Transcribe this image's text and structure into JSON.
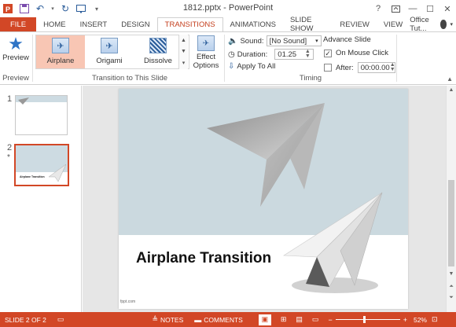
{
  "window": {
    "title": "1812.pptx - PowerPoint",
    "help_label": "?",
    "controls": [
      "restore-icon",
      "minimize-icon",
      "maximize-icon",
      "close-icon"
    ]
  },
  "tabs": [
    {
      "label": "FILE"
    },
    {
      "label": "HOME"
    },
    {
      "label": "INSERT"
    },
    {
      "label": "DESIGN"
    },
    {
      "label": "TRANSITIONS"
    },
    {
      "label": "ANIMATIONS"
    },
    {
      "label": "SLIDE SHOW"
    },
    {
      "label": "REVIEW"
    },
    {
      "label": "VIEW"
    }
  ],
  "account": {
    "label": "Office Tut..."
  },
  "ribbon": {
    "preview": {
      "label": "Preview",
      "group": "Preview"
    },
    "transitions": {
      "items": [
        {
          "label": "Airplane"
        },
        {
          "label": "Origami"
        },
        {
          "label": "Dissolve"
        }
      ],
      "group": "Transition to This Slide",
      "effect_options": "Effect Options"
    },
    "timing": {
      "sound_label": "Sound:",
      "sound_value": "[No Sound]",
      "duration_label": "Duration:",
      "duration_value": "01.25",
      "apply_all": "Apply To All",
      "advance_label": "Advance Slide",
      "on_click": "On Mouse Click",
      "on_click_checked": true,
      "after_label": "After:",
      "after_value": "00:00.00",
      "after_checked": false,
      "group": "Timing"
    }
  },
  "thumbnails": [
    {
      "num": "1",
      "title": ""
    },
    {
      "num": "2",
      "title": "Airplane Transition",
      "star": "*"
    }
  ],
  "slide": {
    "title": "Airplane Transition",
    "footer": "fppt.com",
    "colors": {
      "band": "#cbd9df"
    }
  },
  "statusbar": {
    "slide_info": "SLIDE 2 OF 2",
    "notes": "NOTES",
    "comments": "COMMENTS",
    "zoom": "52%"
  },
  "colors": {
    "accent": "#d24726"
  }
}
